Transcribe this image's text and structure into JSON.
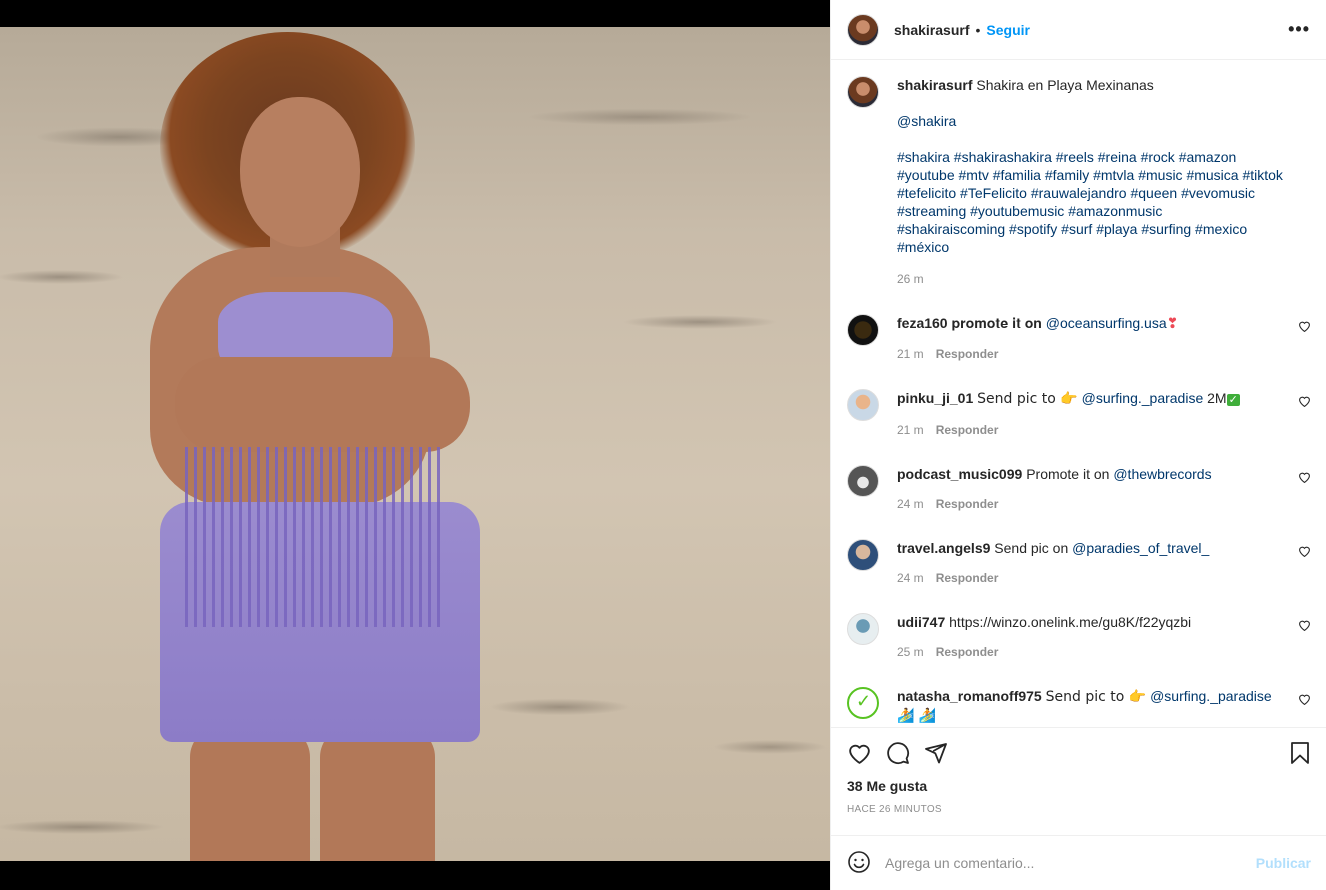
{
  "header": {
    "username": "shakirasurf",
    "separator": "•",
    "follow_label": "Seguir",
    "more_label": "•••"
  },
  "caption": {
    "username": "shakirasurf",
    "text": "Shakira en Playa Mexinanas",
    "mention": "@shakira",
    "hashtags_1": "#shakira #shakirashakira #reels #reina #rock #amazon #youtube #mtv #familia #family #mtvla #music #musica #tiktok #tefelicito #TeFelicito #rauwalejandro #queen #vevomusic #streaming #youtubemusic #amazonmusic",
    "hashtags_2": "#shakiraiscoming #spotify #surf #playa #surfing #mexico #méxico",
    "time": "26 m"
  },
  "comments": [
    {
      "username": "feza160",
      "text": "𝐩𝐫𝐨𝐦𝐨𝐭𝐞 𝐢𝐭 𝐨𝐧",
      "mention": "@oceansurfing.usa",
      "suffix": "❣",
      "time": "21 m",
      "reply": "Responder"
    },
    {
      "username": "pinku_ji_01",
      "text": "Send pic to 👉",
      "mention": "@surfing._paradise",
      "suffix": "2M",
      "check": "✓",
      "time": "21 m",
      "reply": "Responder"
    },
    {
      "username": "podcast_music099",
      "text": "Promote it on",
      "mention": "@thewbrecords",
      "time": "24 m",
      "reply": "Responder"
    },
    {
      "username": "travel.angels9",
      "text": "Send pic on",
      "mention": "@paradies_of_travel_",
      "time": "24 m",
      "reply": "Responder"
    },
    {
      "username": "udii747",
      "text": "https://winzo.onelink.me/gu8K/f22yqzbi",
      "time": "25 m",
      "reply": "Responder"
    },
    {
      "username": "natasha_romanoff975",
      "text": "Send pic to 👉",
      "mention": "@surfing._paradise",
      "suffix": "🏄 🏄"
    }
  ],
  "actions": {
    "likes": "38 Me gusta",
    "when": "HACE 26 MINUTOS"
  },
  "add_comment": {
    "placeholder": "Agrega un comentario...",
    "publish_label": "Publicar"
  },
  "icons": {
    "like": "heart-icon",
    "comment": "comment-icon",
    "share": "send-icon",
    "save": "bookmark-icon",
    "emoji": "emoji-icon"
  },
  "colors": {
    "accent": "#0095f6",
    "link": "#00376b",
    "muted": "#8e8e8e",
    "publish_disabled": "#b2dffc"
  }
}
